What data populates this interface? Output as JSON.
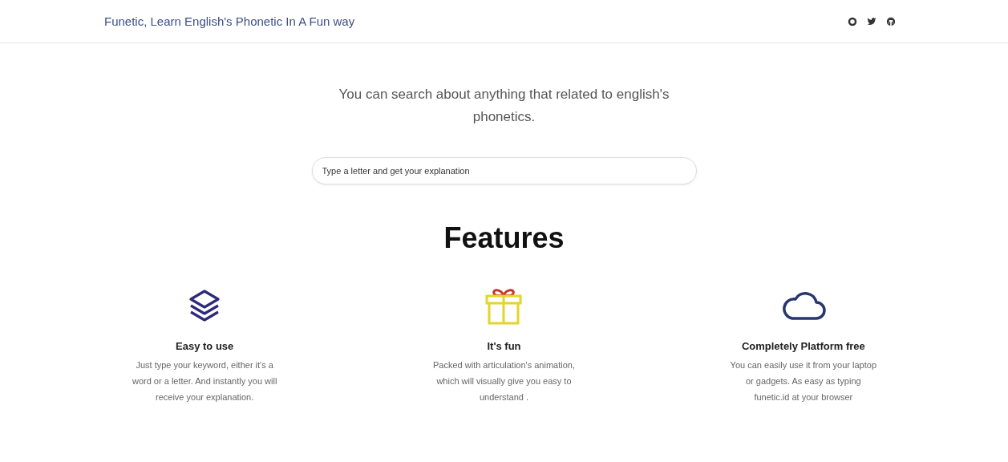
{
  "header": {
    "title": "Funetic, Learn English's Phonetic In A Fun way",
    "social_links": [
      {
        "kind": "ring"
      },
      {
        "kind": "bird"
      },
      {
        "kind": "octocat"
      }
    ]
  },
  "hero": {
    "text": "You can search about anything that related to english's phonetics.",
    "search": {
      "placeholder": "Type a letter and get your explanation"
    }
  },
  "features": {
    "heading": "Features",
    "items": [
      {
        "kind": "layers",
        "title": "Easy to use",
        "description": "Just type your keyword, either it's a word or a letter. And instantly you will receive your explanation."
      },
      {
        "kind": "gift",
        "title": "It's fun",
        "description": "Packed with articulation's animation, which will visually give you easy to understand ."
      },
      {
        "kind": "cloud",
        "title": "Completely Platform free",
        "description": "You can easily use it from your laptop or gadgets. As easy as typing funetic.id at your browser"
      }
    ]
  }
}
